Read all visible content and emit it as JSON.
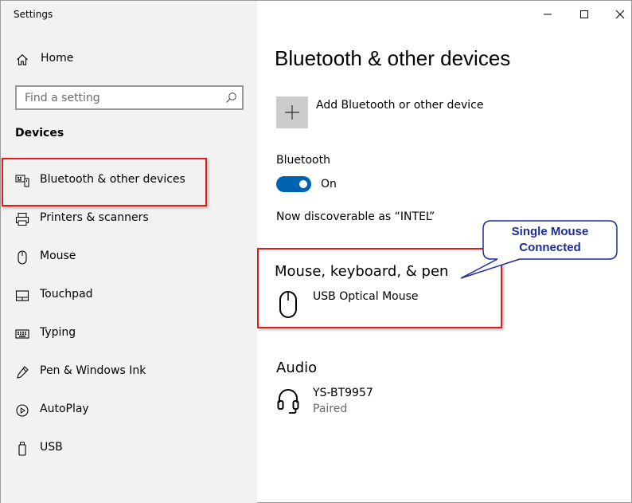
{
  "window": {
    "app_title": "Settings",
    "controls": {
      "minimize_icon": "minimize-icon",
      "maximize_icon": "maximize-icon",
      "close_icon": "close-icon"
    }
  },
  "sidebar": {
    "home_label": "Home",
    "search_placeholder": "Find a setting",
    "section_title": "Devices",
    "items": [
      {
        "label": "Bluetooth & other devices",
        "icon": "bluetooth-devices-icon",
        "selected": true
      },
      {
        "label": "Printers & scanners",
        "icon": "printer-icon",
        "selected": false
      },
      {
        "label": "Mouse",
        "icon": "mouse-icon",
        "selected": false
      },
      {
        "label": "Touchpad",
        "icon": "touchpad-icon",
        "selected": false
      },
      {
        "label": "Typing",
        "icon": "keyboard-icon",
        "selected": false
      },
      {
        "label": "Pen & Windows Ink",
        "icon": "pen-icon",
        "selected": false
      },
      {
        "label": "AutoPlay",
        "icon": "autoplay-icon",
        "selected": false
      },
      {
        "label": "USB",
        "icon": "usb-icon",
        "selected": false
      }
    ]
  },
  "main": {
    "page_title": "Bluetooth & other devices",
    "add_device_label": "Add Bluetooth or other device",
    "bluetooth": {
      "label": "Bluetooth",
      "state": "On",
      "enabled": true
    },
    "discoverable_text": "Now discoverable as “INTEL”",
    "mouse_keyboard_pen": {
      "title": "Mouse, keyboard, & pen",
      "devices": [
        {
          "name": "USB Optical Mouse",
          "icon": "mouse-icon"
        }
      ]
    },
    "audio": {
      "title": "Audio",
      "devices": [
        {
          "name": "YS-BT9957",
          "status": "Paired",
          "icon": "headset-icon"
        }
      ]
    }
  },
  "annotation": {
    "callout_line1": "Single Mouse",
    "callout_line2": "Connected",
    "highlight_color": "#e21b1b",
    "callout_color": "#1a2d9a"
  },
  "colors": {
    "accent": "#0063b1",
    "sidebar_bg": "#f2f2f2",
    "add_button_bg": "#cccccc"
  }
}
